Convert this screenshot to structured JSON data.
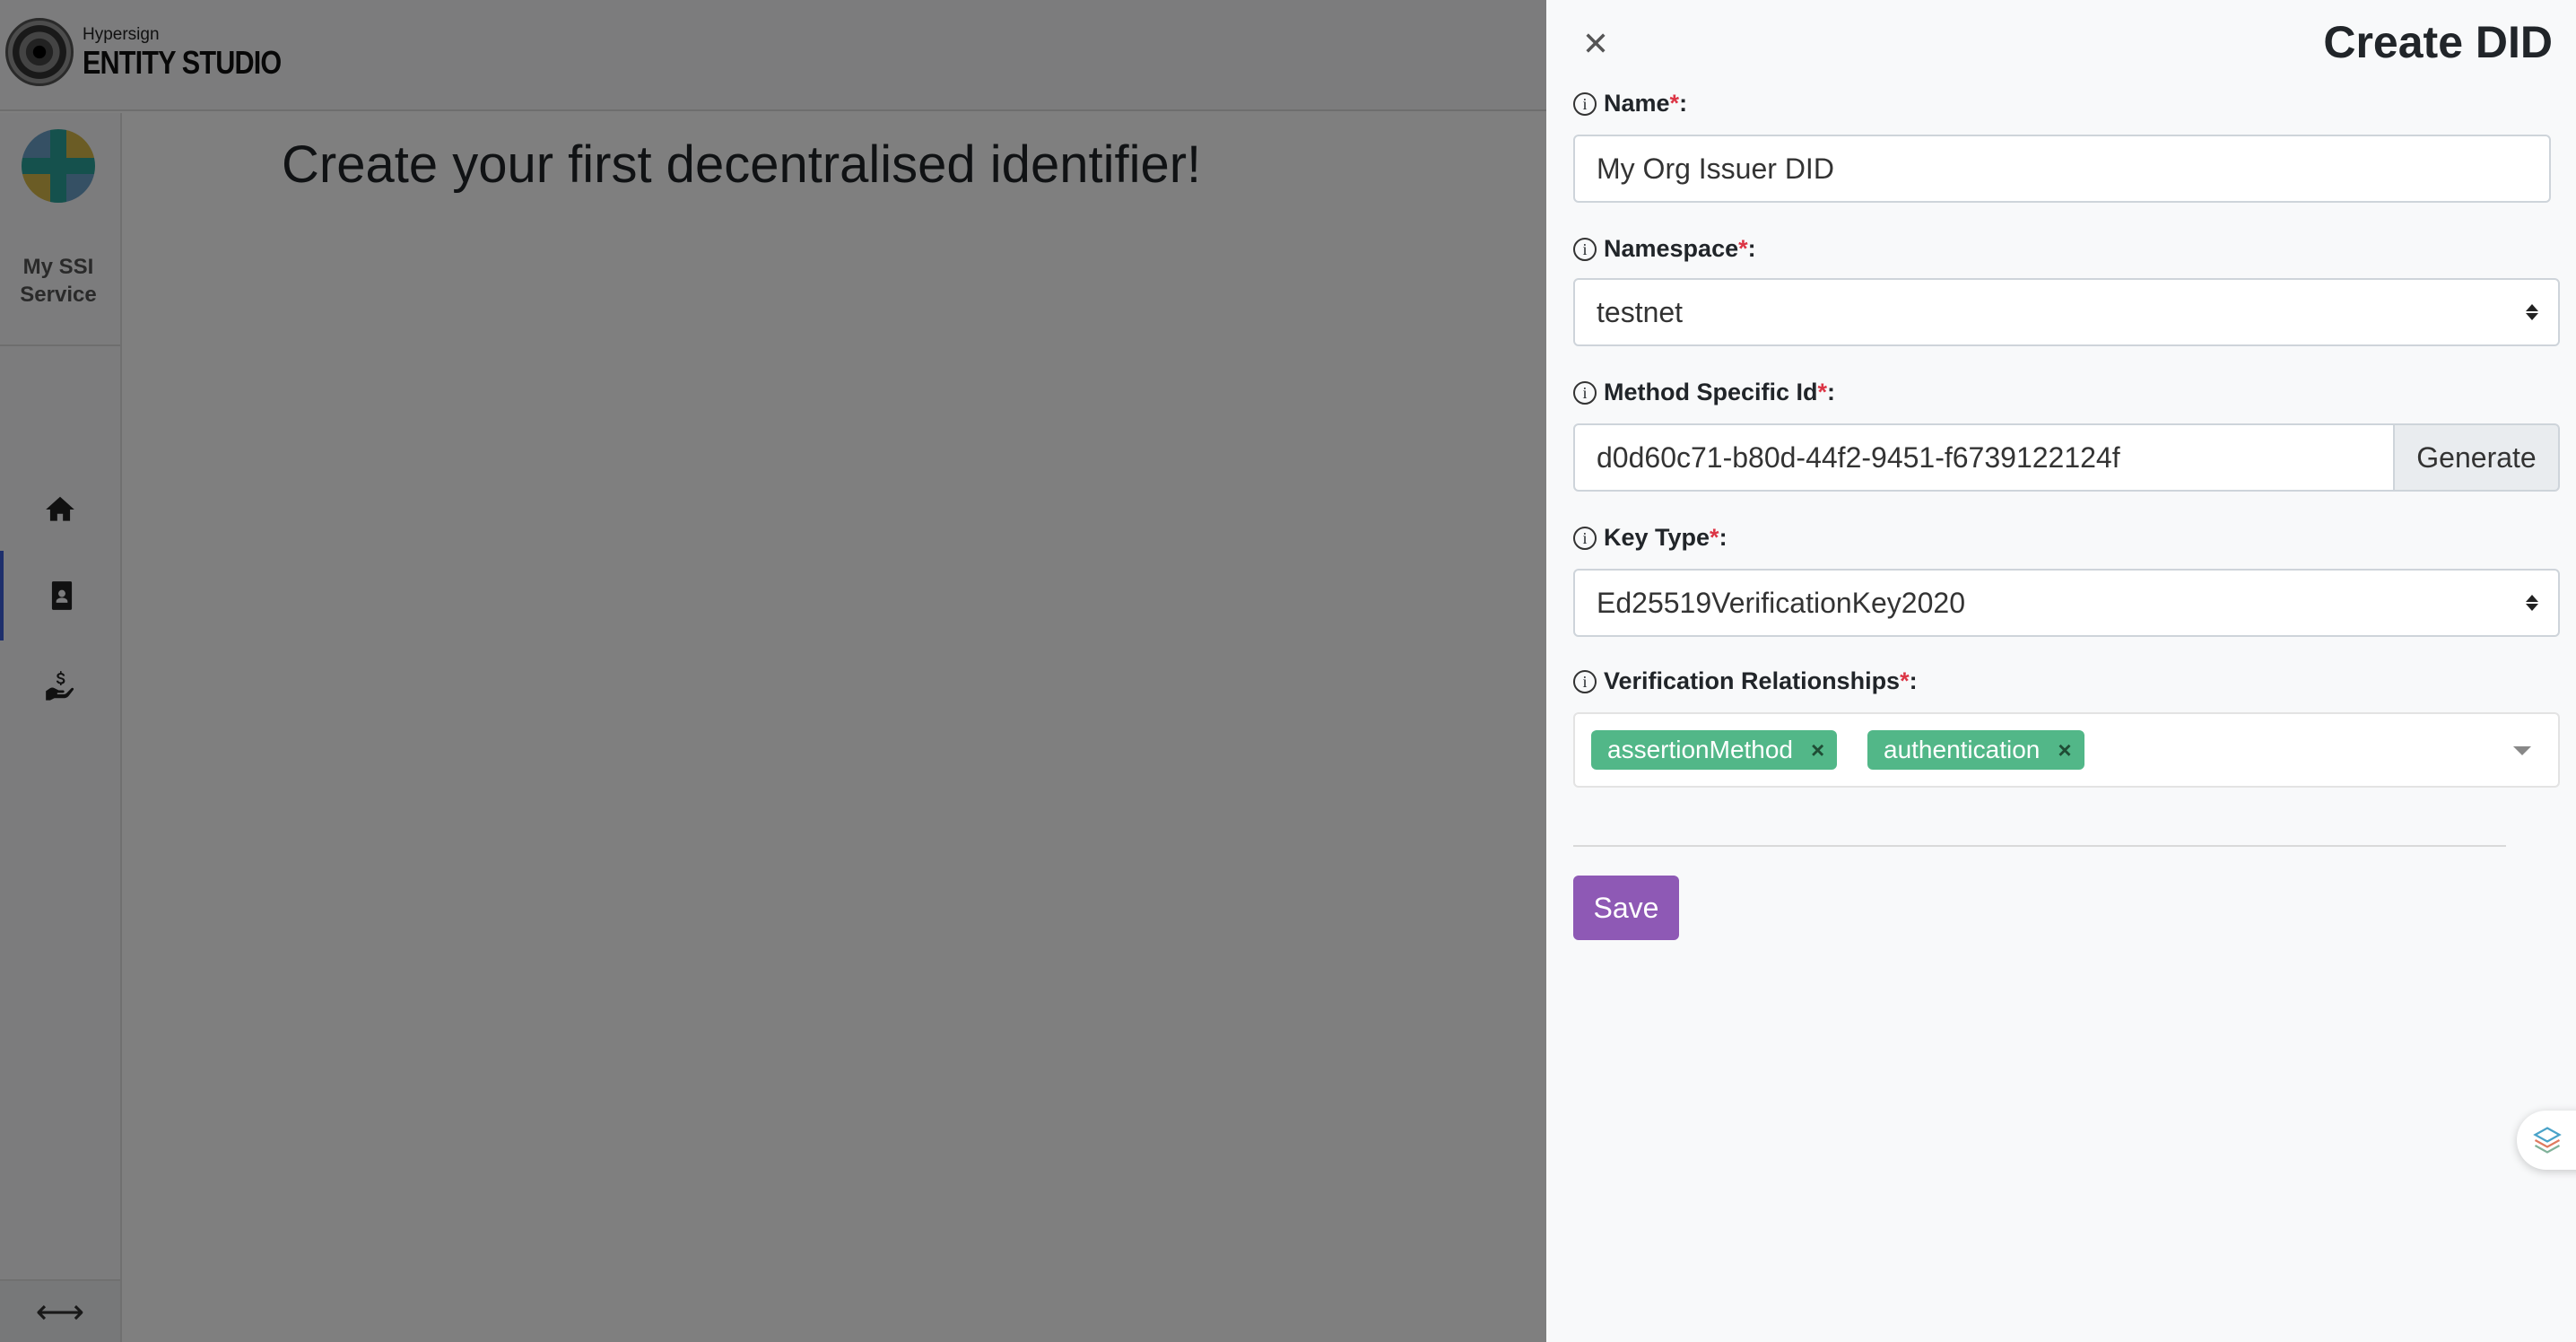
{
  "app": {
    "logo_small": "Hypersign",
    "logo_big": "ENTITY STUDIO",
    "service_name": "My SSI Service",
    "main_heading": "Create your first decentralised identifier!",
    "nav_icons": [
      "home-icon",
      "id-badge-icon",
      "hand-dollar-icon"
    ],
    "collapse_icon": "⟷"
  },
  "panel": {
    "title": "Create DID",
    "close_icon": "close-icon",
    "fields": {
      "name": {
        "label": "Name",
        "required_mark": "*",
        "colon": ":",
        "value": "My Org Issuer DID"
      },
      "namespace": {
        "label": "Namespace",
        "required_mark": "*",
        "colon": ":",
        "value": "testnet"
      },
      "method_specific_id": {
        "label": "Method Specific Id",
        "required_mark": "*",
        "colon": ":",
        "value": "d0d60c71-b80d-44f2-9451-f6739122124f",
        "button": "Generate"
      },
      "key_type": {
        "label": "Key Type",
        "required_mark": "*",
        "colon": ":",
        "value": "Ed25519VerificationKey2020"
      },
      "verification_relationships": {
        "label": "Verification Relationships",
        "required_mark": "*",
        "colon": ":",
        "tags": [
          "assertionMethod",
          "authentication"
        ],
        "tag_remove": "×"
      }
    },
    "save_label": "Save",
    "info_glyph": "i"
  },
  "colors": {
    "primary_purple": "#8e59b5",
    "tag_green": "#52b788",
    "required_red": "#dc3545",
    "nav_active": "#3d5fd9"
  }
}
